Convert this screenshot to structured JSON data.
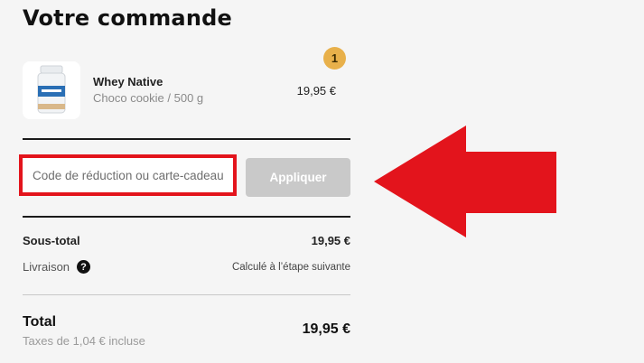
{
  "header": {
    "title": "Votre commande"
  },
  "cart": {
    "items": [
      {
        "name": "Whey Native",
        "variant": "Choco cookie / 500 g",
        "price": "19,95 €",
        "quantity": "1",
        "thumbnail_icon": "product-tub-icon"
      }
    ]
  },
  "discount": {
    "placeholder": "Code de réduction ou carte-cadeau",
    "apply_label": "Appliquer"
  },
  "summary": {
    "subtotal_label": "Sous-total",
    "subtotal_value": "19,95 €",
    "shipping_label": "Livraison",
    "shipping_help_icon": "question-circle-icon",
    "shipping_value": "Calculé à l’étape suivante",
    "total_label": "Total",
    "tax_note": "Taxes de 1,04 € incluse",
    "total_value": "19,95 €"
  },
  "annotation": {
    "arrow_icon": "left-arrow-icon",
    "color": "#e3141c"
  }
}
